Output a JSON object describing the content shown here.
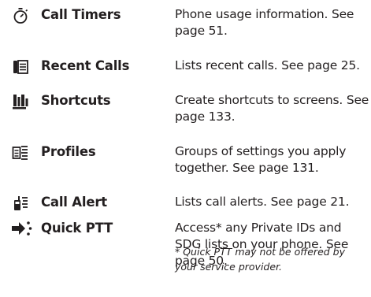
{
  "entries": [
    {
      "icon": "timer-icon",
      "name": "Call Timers",
      "description": "Phone usage information. See page 51."
    },
    {
      "icon": "recent-calls-icon",
      "name": "Recent Calls",
      "description": "Lists recent calls. See page 25."
    },
    {
      "icon": "shortcuts-icon",
      "name": "Shortcuts",
      "description": "Create shortcuts to screens. See page 133."
    },
    {
      "icon": "profiles-icon",
      "name": "Profiles",
      "description": "Groups of settings you apply together. See page 131."
    },
    {
      "icon": "call-alert-icon",
      "name": "Call Alert",
      "description": "Lists call alerts. See page 21."
    },
    {
      "icon": "quick-ptt-icon",
      "name": "Quick PTT",
      "description": "Access* any Private IDs and SDG lists on your phone. See page 50."
    }
  ],
  "footnote": "* Quick PTT may not be offered by your service provider."
}
